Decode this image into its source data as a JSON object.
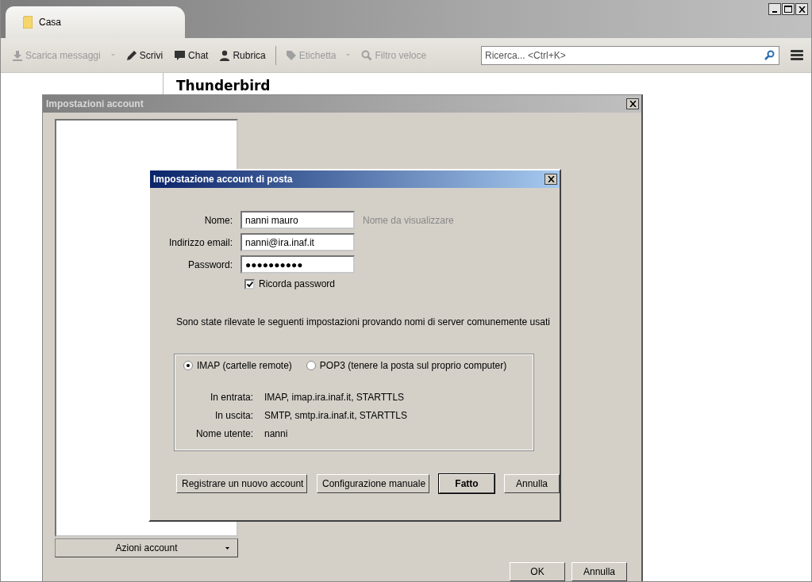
{
  "window": {
    "controls": [
      {
        "kind": "minimize"
      },
      {
        "kind": "maximize"
      },
      {
        "kind": "close"
      }
    ],
    "tabs": [
      {
        "label": "Casa",
        "selected": true
      }
    ],
    "toolbar": [
      {
        "label": "Scarica messaggi",
        "disabled": true,
        "dropdown": true
      },
      {
        "label": "Scrivi",
        "disabled": false,
        "dropdown": false
      },
      {
        "label": "Chat",
        "disabled": false,
        "dropdown": false
      },
      {
        "label": "Rubrica",
        "disabled": false,
        "dropdown": false
      },
      {
        "label": "Etichetta",
        "disabled": true,
        "dropdown": true
      },
      {
        "label": "Filtro veloce",
        "disabled": true,
        "dropdown": false
      }
    ],
    "search": {
      "placeholder": "Ricerca... <Ctrl+K>"
    },
    "heading": "Thunderbird"
  },
  "account_settings": {
    "title": "Impostazioni account",
    "actions_button": "Azioni account",
    "buttons": [
      "OK",
      "Annulla"
    ]
  },
  "mail_setup": {
    "title": "Impostazione account di posta",
    "fields": [
      {
        "label": "Nome:",
        "value": "nanni mauro",
        "hint": "Nome da visualizzare"
      },
      {
        "label": "Indirizzo email:",
        "value": "nanni@ira.inaf.it"
      },
      {
        "label": "Password:",
        "value": "●●●●●●●●●●"
      }
    ],
    "remember_password": {
      "label": "Ricorda password",
      "checked": true
    },
    "notice": "Sono state rilevate le seguenti impostazioni provando nomi di server comunemente usati",
    "protocols": [
      {
        "label": "IMAP (cartelle remote)",
        "selected": true
      },
      {
        "label": "POP3 (tenere la posta sul proprio computer)",
        "selected": false
      }
    ],
    "details": [
      {
        "label": "In entrata:",
        "value": "IMAP, imap.ira.inaf.it, STARTTLS"
      },
      {
        "label": "In uscita:",
        "value": "SMTP, smtp.ira.inaf.it, STARTTLS"
      },
      {
        "label": "Nome utente:",
        "value": "nanni"
      }
    ],
    "buttons": [
      {
        "label": "Registrare un nuovo account",
        "default": false
      },
      {
        "label": "Configurazione manuale",
        "default": false
      },
      {
        "label": "Fatto",
        "default": true
      },
      {
        "label": "Annulla",
        "default": false
      }
    ]
  }
}
